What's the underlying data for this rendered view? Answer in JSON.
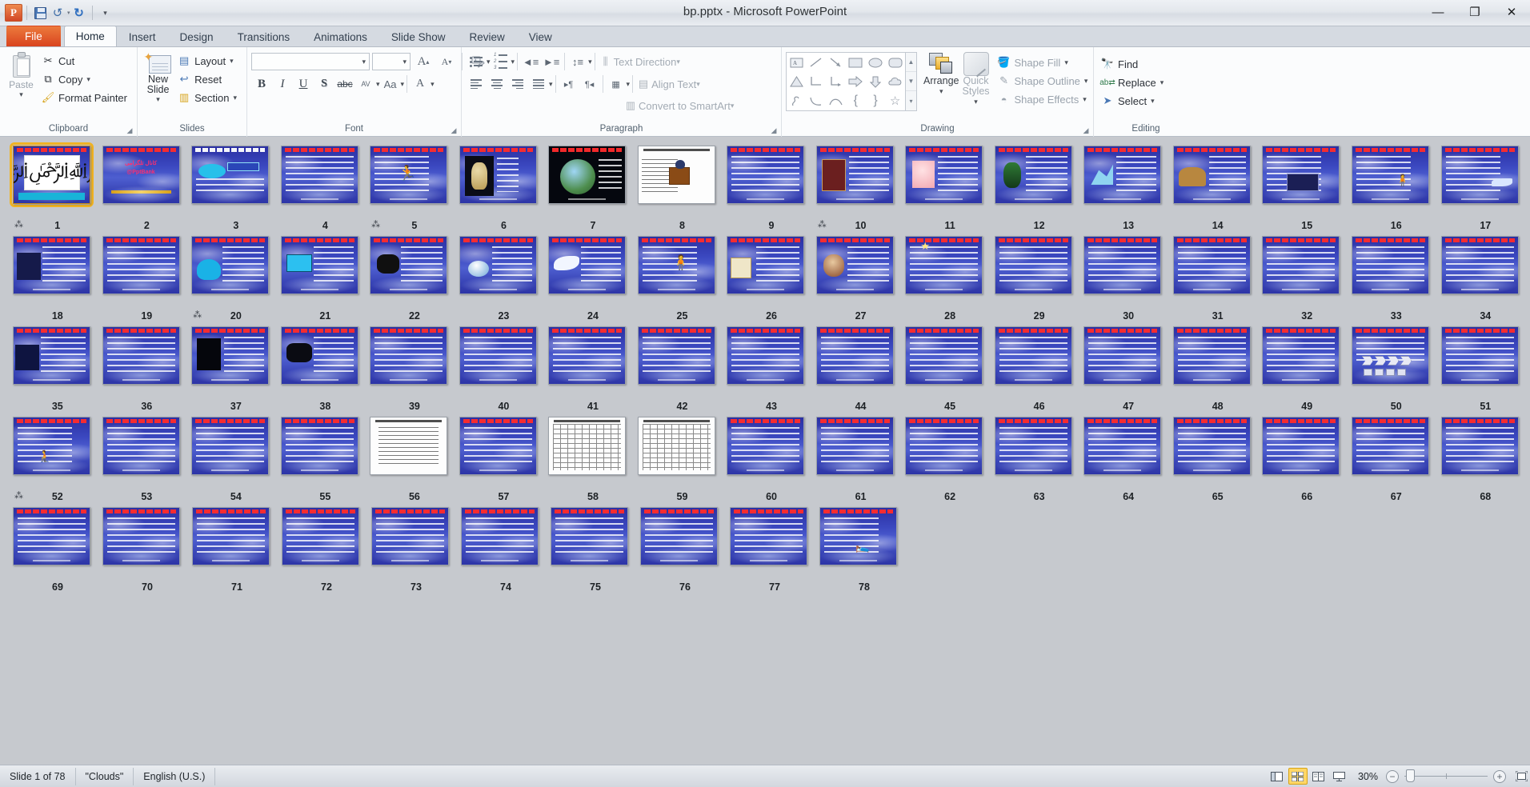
{
  "window": {
    "title": "bp.pptx - Microsoft PowerPoint",
    "app_logo": "P",
    "minimize": "—",
    "restore": "❐",
    "close": "✕",
    "ribbon_collapse": "⌃",
    "help": "?"
  },
  "quick_access": {
    "save": "save-icon",
    "undo": "undo-icon",
    "redo": "redo-icon",
    "customize": "customize-qat-icon"
  },
  "tabs": [
    {
      "label": "File",
      "active": false,
      "kind": "file"
    },
    {
      "label": "Home",
      "active": true
    },
    {
      "label": "Insert",
      "active": false
    },
    {
      "label": "Design",
      "active": false
    },
    {
      "label": "Transitions",
      "active": false
    },
    {
      "label": "Animations",
      "active": false
    },
    {
      "label": "Slide Show",
      "active": false
    },
    {
      "label": "Review",
      "active": false
    },
    {
      "label": "View",
      "active": false
    }
  ],
  "ribbon": {
    "clipboard": {
      "group_label": "Clipboard",
      "paste": "Paste",
      "cut": "Cut",
      "copy": "Copy",
      "format_painter": "Format Painter"
    },
    "slides": {
      "group_label": "Slides",
      "new_slide": "New Slide",
      "layout": "Layout",
      "reset": "Reset",
      "section": "Section"
    },
    "font": {
      "group_label": "Font",
      "font_name": "",
      "font_size": "",
      "grow_font": "A",
      "shrink_font": "A",
      "clear_formatting": "clear-formatting-icon",
      "bold": "B",
      "italic": "I",
      "underline": "U",
      "shadow": "S",
      "strikethrough": "abc",
      "character_spacing": "AV",
      "change_case": "Aa",
      "font_color": "A"
    },
    "paragraph": {
      "group_label": "Paragraph",
      "text_direction": "Text Direction",
      "align_text": "Align Text",
      "convert_to_smartart": "Convert to SmartArt"
    },
    "drawing": {
      "group_label": "Drawing",
      "arrange": "Arrange",
      "quick_styles": "Quick Styles",
      "shape_fill": "Shape Fill",
      "shape_outline": "Shape Outline",
      "shape_effects": "Shape Effects"
    },
    "editing": {
      "group_label": "Editing",
      "find": "Find",
      "replace": "Replace",
      "select": "Select"
    }
  },
  "status_bar": {
    "slide_counter": "Slide 1 of 78",
    "theme": "\"Clouds\"",
    "language": "English (U.S.)",
    "zoom_level": "30%",
    "views": [
      {
        "name": "normal-view",
        "active": false
      },
      {
        "name": "slide-sorter-view",
        "active": true
      },
      {
        "name": "reading-view",
        "active": false
      },
      {
        "name": "slide-show-view",
        "active": false
      }
    ],
    "zoom_out": "−",
    "zoom_in": "+",
    "fit_to_window": "fit-slide-to-window-icon"
  },
  "sorter": {
    "selected_slide": 1,
    "total_slides": 78,
    "per_row": 17,
    "slides": [
      {
        "n": 1,
        "style": "calligraphy",
        "anim": true
      },
      {
        "n": 2,
        "style": "pinktitle"
      },
      {
        "n": 3,
        "style": "cloudbox"
      },
      {
        "n": 4,
        "style": "text"
      },
      {
        "n": 5,
        "style": "figure-diver",
        "anim": true
      },
      {
        "n": 6,
        "style": "thinker-dark"
      },
      {
        "n": 7,
        "style": "circle-photo"
      },
      {
        "n": 8,
        "style": "doc-podium"
      },
      {
        "n": 9,
        "style": "text"
      },
      {
        "n": 10,
        "style": "figure-people",
        "anim": true
      },
      {
        "n": 11,
        "style": "figure-pink"
      },
      {
        "n": 12,
        "style": "figure-plant"
      },
      {
        "n": 13,
        "style": "figure-chart"
      },
      {
        "n": 14,
        "style": "figure-camel"
      },
      {
        "n": 15,
        "style": "factory"
      },
      {
        "n": 16,
        "style": "figure-person"
      },
      {
        "n": 17,
        "style": "figure-bird"
      },
      {
        "n": 18,
        "style": "figure-crowd"
      },
      {
        "n": 19,
        "style": "text"
      },
      {
        "n": 20,
        "style": "figure-blob",
        "anim": true
      },
      {
        "n": 21,
        "style": "figure-screen"
      },
      {
        "n": 22,
        "style": "figure-cow"
      },
      {
        "n": 23,
        "style": "figure-ball"
      },
      {
        "n": 24,
        "style": "figure-bird2"
      },
      {
        "n": 25,
        "style": "figure-standing"
      },
      {
        "n": 26,
        "style": "figure-box"
      },
      {
        "n": 27,
        "style": "figure-face"
      },
      {
        "n": 28,
        "style": "figure-star",
        "anim": false
      },
      {
        "n": 29,
        "style": "text"
      },
      {
        "n": 30,
        "style": "text"
      },
      {
        "n": 31,
        "style": "text"
      },
      {
        "n": 32,
        "style": "text"
      },
      {
        "n": 33,
        "style": "text"
      },
      {
        "n": 34,
        "style": "text"
      },
      {
        "n": 35,
        "style": "figure-crowd2"
      },
      {
        "n": 36,
        "style": "text"
      },
      {
        "n": 37,
        "style": "figure-rig"
      },
      {
        "n": 38,
        "style": "figure-dark"
      },
      {
        "n": 39,
        "style": "text"
      },
      {
        "n": 40,
        "style": "text"
      },
      {
        "n": 41,
        "style": "text"
      },
      {
        "n": 42,
        "style": "text"
      },
      {
        "n": 43,
        "style": "text"
      },
      {
        "n": 44,
        "style": "text"
      },
      {
        "n": 45,
        "style": "text"
      },
      {
        "n": 46,
        "style": "text"
      },
      {
        "n": 47,
        "style": "text"
      },
      {
        "n": 48,
        "style": "text"
      },
      {
        "n": 49,
        "style": "text"
      },
      {
        "n": 50,
        "style": "arrows"
      },
      {
        "n": 51,
        "style": "text"
      },
      {
        "n": 52,
        "style": "figure-sit",
        "anim": true
      },
      {
        "n": 53,
        "style": "text"
      },
      {
        "n": 54,
        "style": "text"
      },
      {
        "n": 55,
        "style": "text"
      },
      {
        "n": 56,
        "style": "doc-white"
      },
      {
        "n": 57,
        "style": "text"
      },
      {
        "n": 58,
        "style": "flowchart"
      },
      {
        "n": 59,
        "style": "flowchart"
      },
      {
        "n": 60,
        "style": "text"
      },
      {
        "n": 61,
        "style": "text"
      },
      {
        "n": 62,
        "style": "text"
      },
      {
        "n": 63,
        "style": "text"
      },
      {
        "n": 64,
        "style": "text"
      },
      {
        "n": 65,
        "style": "text"
      },
      {
        "n": 66,
        "style": "text"
      },
      {
        "n": 67,
        "style": "text"
      },
      {
        "n": 68,
        "style": "text"
      },
      {
        "n": 69,
        "style": "text"
      },
      {
        "n": 70,
        "style": "text"
      },
      {
        "n": 71,
        "style": "text"
      },
      {
        "n": 72,
        "style": "text"
      },
      {
        "n": 73,
        "style": "text"
      },
      {
        "n": 74,
        "style": "text"
      },
      {
        "n": 75,
        "style": "text"
      },
      {
        "n": 76,
        "style": "text"
      },
      {
        "n": 77,
        "style": "text"
      },
      {
        "n": 78,
        "style": "figure-lying"
      }
    ]
  },
  "colors": {
    "accent_orange": "#d9441f",
    "selection_gold": "#f0b323",
    "slide_blue": "#3b48c0",
    "ribbon_bg": "#fbfcfd",
    "workspace_bg": "#c6c9ce"
  }
}
